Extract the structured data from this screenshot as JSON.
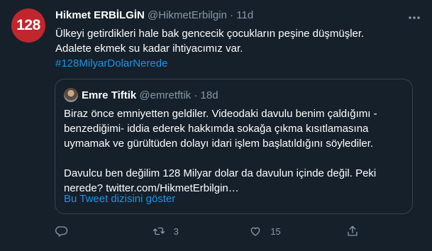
{
  "tweet": {
    "avatar_text": "128",
    "author_name": "Hikmet ERBİLGİN",
    "author_handle": "@HikmetErbilgin",
    "separator": "·",
    "time": "11d",
    "line1": "Ülkeyi getirdikleri hale bak gencecik çocukların peşine düşmüşler.",
    "line2": "Adalete ekmek su kadar ihtiyacımız var.",
    "hashtag": "#128MilyarDolarNerede"
  },
  "quoted": {
    "author_name": "Emre Tiftik",
    "author_handle": "@emretftik",
    "separator": "·",
    "time": "18d",
    "paragraph1": "Biraz önce emniyetten geldiler. Videodaki davulu benim çaldığımı -benzediğimi- iddia ederek hakkımda sokağa çıkma kısıtlamasına uymamak ve gürültüden dolayı idari işlem başlatıldığını söylediler.",
    "paragraph2": "Davulcu ben değilim 128 Milyar dolar da davulun içinde değil. Peki nerede? twitter.com/HikmetErbilgin…",
    "thread_link": "Bu Tweet dizisini göster"
  },
  "actions": {
    "reply_icon": "reply-icon",
    "retweet_icon": "retweet-icon",
    "retweet_count": "3",
    "like_icon": "heart-icon",
    "like_count": "15",
    "share_icon": "share-icon"
  },
  "colors": {
    "background": "#15202b",
    "accent": "#1b95e0",
    "muted": "#8899a6",
    "border": "#38444d",
    "avatar": "#c0262d"
  }
}
